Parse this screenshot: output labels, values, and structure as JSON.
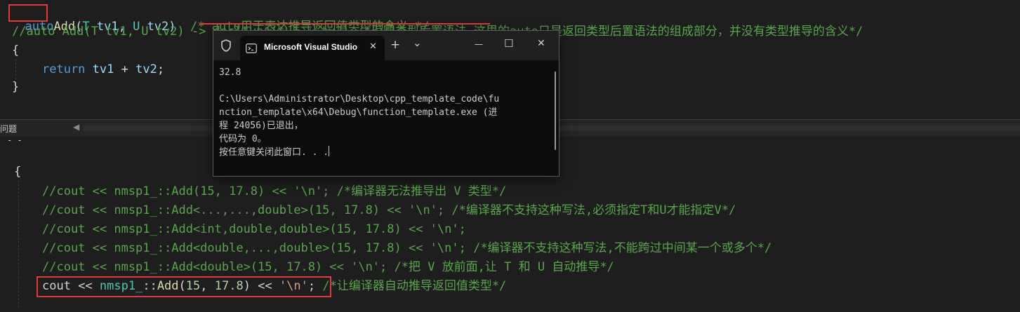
{
  "editor_top": {
    "line1": {
      "kw": "auto",
      "fn": "Add",
      "open": "(",
      "t": "T",
      "tv1": " tv1, ",
      "u": "U",
      "tv2": " tv2)",
      "comment": "  /* auto用于表达推导返回值类型的含义 */"
    },
    "line2": "//auto Add(T tv1, U tv2) -> decltype(tv1 + tv2) /*返回类型后置语法,这里的auto只是返回类型后置语法的组成部分，并没有类型推导的含义*/",
    "line3": "{",
    "line4": {
      "kw": "return",
      "a": " tv1",
      "op": " + ",
      "b": "tv2",
      ";": ";"
    },
    "line5": "}"
  },
  "pane": {
    "label": "问题",
    "arrow": "◀"
  },
  "editor_bottom": {
    "brace": "{",
    "c1": "//cout << nmsp1_::Add(15, 17.8) << '\\n'; /*编译器无法推导出 V 类型*/",
    "c2": "//cout << nmsp1_::Add<...,...,double>(15, 17.8) << '\\n'; /*编译器不支持这种写法,必须指定T和U才能指定V*/",
    "c3": "//cout << nmsp1_::Add<int,double,double>(15, 17.8) << '\\n';",
    "c4": "//cout << nmsp1_::Add<double,...,double>(15, 17.8) << '\\n'; /*编译器不支持这种写法,不能跨过中间某一个或多个*/",
    "c5": "//cout << nmsp1_::Add<double>(15, 17.8) << '\\n'; /*把 V 放前面,让 T 和 U 自动推导*/",
    "last": {
      "cout": "cout",
      "op1": " << ",
      "ns": "nmsp1_",
      "scope": "::",
      "fn": "Add",
      "args_open": "(",
      "n1": "15",
      "comma": ", ",
      "n2": "17.8",
      "args_close": ")",
      "op2": " << ",
      "str": "'\\n'",
      "semi": ";",
      "comment": " /*让编译器自动推导返回值类型*/"
    }
  },
  "console": {
    "tab_title": "Microsoft Visual Studio",
    "shield_icon": "shield-icon",
    "terminal_icon": "terminal-icon",
    "plus": "+",
    "chevron": "⌄",
    "minimize": "—",
    "maximize": "☐",
    "close": "✕",
    "output": "32.8\n\nC:\\Users\\Administrator\\Desktop\\cpp_template_code\\fu\nnction_template\\x64\\Debug\\function_template.exe (进\n程 24056)已退出，\n代码为 0。\n按任意键关闭此窗口. . ."
  }
}
